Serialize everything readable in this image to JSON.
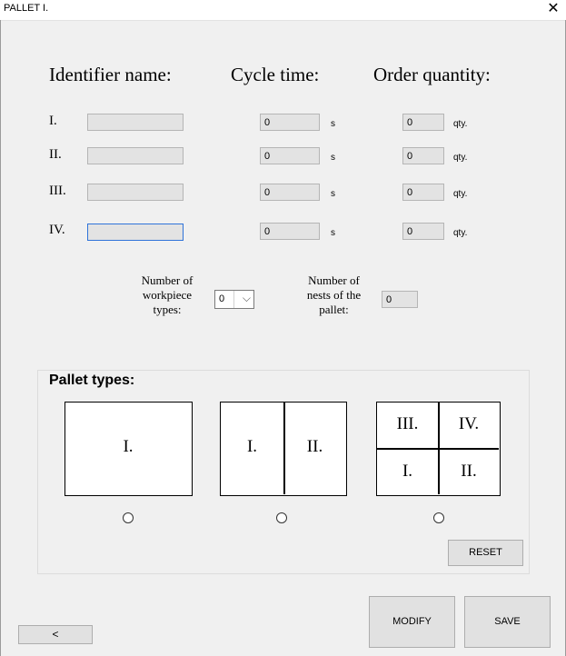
{
  "window": {
    "title": "PALLET I.",
    "close_glyph": "✕"
  },
  "headers": {
    "identifier": "Identifier name:",
    "cycle": "Cycle time:",
    "order": "Order quantity:"
  },
  "rows": [
    {
      "label": "I.",
      "identifier": "",
      "cycle": "0",
      "cycle_unit": "s",
      "qty": "0",
      "qty_unit": "qty."
    },
    {
      "label": "II.",
      "identifier": "",
      "cycle": "0",
      "cycle_unit": "s",
      "qty": "0",
      "qty_unit": "qty."
    },
    {
      "label": "III.",
      "identifier": "",
      "cycle": "0",
      "cycle_unit": "s",
      "qty": "0",
      "qty_unit": "qty."
    },
    {
      "label": "IV.",
      "identifier": "",
      "cycle": "0",
      "cycle_unit": "s",
      "qty": "0",
      "qty_unit": "qty."
    }
  ],
  "workpiece": {
    "label_lines": [
      "Number of",
      "workpiece",
      "types:"
    ],
    "value": "0"
  },
  "nests": {
    "label_lines": [
      "Number of",
      "nests of the",
      "pallet:"
    ],
    "value": "0"
  },
  "pallet_types": {
    "title": "Pallet types:",
    "single": [
      "I."
    ],
    "double": [
      "I.",
      "II."
    ],
    "quad": [
      "III.",
      "IV.",
      "I.",
      "II."
    ]
  },
  "buttons": {
    "reset": "RESET",
    "modify": "MODIFY",
    "save": "SAVE",
    "back": "<"
  },
  "colors": {
    "field_bg": "#e3e3e3",
    "focus_border": "#2f73d9",
    "window_bg": "#f0f0f0"
  }
}
